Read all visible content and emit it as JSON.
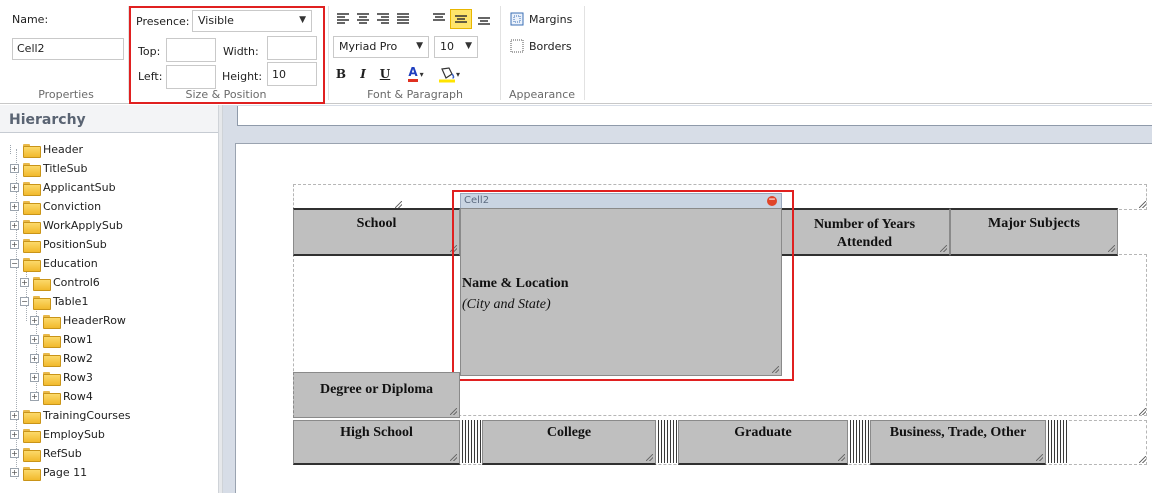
{
  "ribbon": {
    "properties": {
      "name_label": "Name:",
      "name_value": "Cell2",
      "group_label": "Properties"
    },
    "size_position": {
      "presence_label": "Presence:",
      "presence_value": "Visible",
      "top_label": "Top:",
      "top_value": "",
      "width_label": "Width:",
      "width_value": "",
      "left_label": "Left:",
      "left_value": "",
      "height_label": "Height:",
      "height_value": "10",
      "group_label": "Size & Position"
    },
    "font_paragraph": {
      "font_name": "Myriad Pro",
      "font_size": "10",
      "bold_label": "B",
      "italic_label": "I",
      "underline_label": "U",
      "font_color_label": "A",
      "font_color": "#e03020",
      "highlight_color": "#ffe400",
      "active_valign": "center",
      "group_label": "Font & Paragraph"
    },
    "appearance": {
      "margins_label": "Margins",
      "borders_label": "Borders",
      "group_label": "Appearance"
    }
  },
  "hierarchy": {
    "title": "Hierarchy",
    "items": [
      {
        "label": "Header",
        "expander": "none"
      },
      {
        "label": "TitleSub",
        "expander": "plus"
      },
      {
        "label": "ApplicantSub",
        "expander": "plus"
      },
      {
        "label": "Conviction",
        "expander": "plus"
      },
      {
        "label": "WorkApplySub",
        "expander": "plus"
      },
      {
        "label": "PositionSub",
        "expander": "plus"
      },
      {
        "label": "Education",
        "expander": "minus"
      },
      {
        "label": "Control6",
        "expander": "plus"
      },
      {
        "label": "Table1",
        "expander": "minus"
      },
      {
        "label": "HeaderRow",
        "expander": "plus"
      },
      {
        "label": "Row1",
        "expander": "plus"
      },
      {
        "label": "Row2",
        "expander": "plus"
      },
      {
        "label": "Row3",
        "expander": "plus"
      },
      {
        "label": "Row4",
        "expander": "plus"
      },
      {
        "label": "TrainingCourses",
        "expander": "plus"
      },
      {
        "label": "EmploySub",
        "expander": "plus"
      },
      {
        "label": "RefSub",
        "expander": "plus"
      },
      {
        "label": "Page 11",
        "expander": "plus"
      }
    ]
  },
  "form": {
    "selected_cell_tag": "Cell2",
    "school": "School",
    "name_location": "Name & Location",
    "city_state": "(City and State)",
    "years_line1": "Number of Years",
    "years_line2": "Attended",
    "major_subjects": "Major Subjects",
    "degree": "Degree or Diploma",
    "high_school": "High School",
    "college": "College",
    "graduate": "Graduate",
    "business": "Business, Trade, Other"
  },
  "colors": {
    "highlight_frame": "#e02020",
    "cell_fill": "#bfbfbf",
    "selected_tab": "#c9d4e2",
    "active_button": "#ffe56b"
  }
}
